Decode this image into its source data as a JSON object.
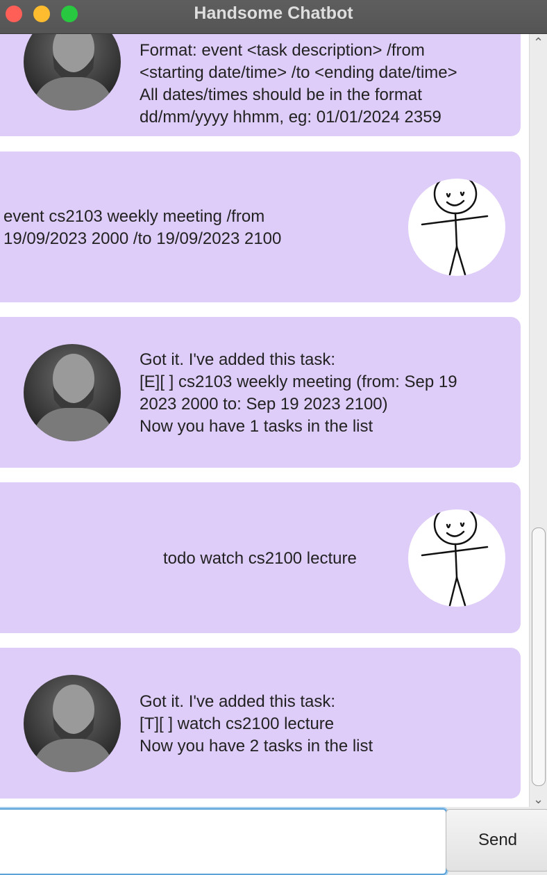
{
  "window": {
    "title": "Handsome Chatbot"
  },
  "messages": [
    {
      "sender": "bot",
      "text": "Format: event <task description> /from\n<starting date/time> /to <ending date/time>\nAll dates/times should be in the format\ndd/mm/yyyy hhmm, eg: 01/01/2024 2359"
    },
    {
      "sender": "user",
      "text": "event cs2103 weekly meeting /from\n19/09/2023 2000 /to 19/09/2023 2100"
    },
    {
      "sender": "bot",
      "text": "Got it. I've added this task:\n[E][ ] cs2103 weekly meeting (from: Sep 19\n2023 2000 to: Sep 19 2023 2100)\nNow you have 1 tasks in the list"
    },
    {
      "sender": "user",
      "text": "todo watch cs2100 lecture"
    },
    {
      "sender": "bot",
      "text": "Got it. I've added this task:\n[T][ ] watch cs2100 lecture\nNow you have 2 tasks in the list"
    }
  ],
  "input": {
    "value": "",
    "placeholder": ""
  },
  "send_button": {
    "label": "Send"
  },
  "icons": {
    "bot_avatar": "bot-avatar-photo",
    "user_avatar": "stick-figure-avatar",
    "scroll_up": "chevron-up-icon",
    "scroll_down": "chevron-down-icon"
  },
  "colors": {
    "bubble": "#dfcdf9",
    "titlebar": "#5a5a5a",
    "input_focus": "#5aa2d8"
  }
}
